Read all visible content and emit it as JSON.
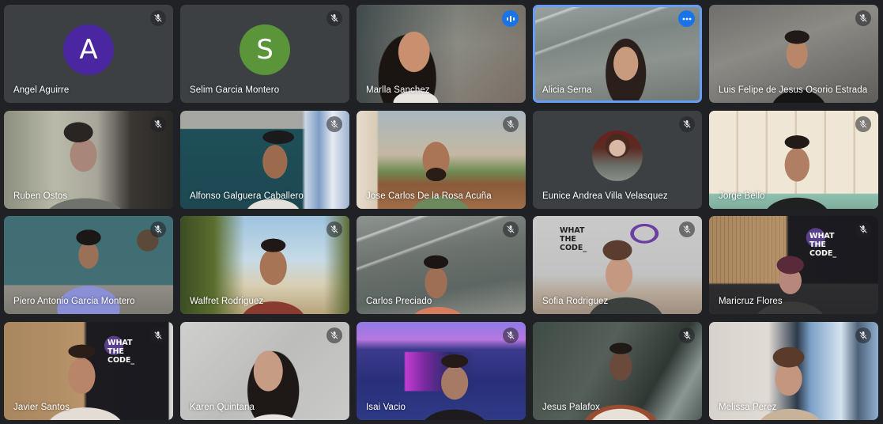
{
  "app": "Google Meet",
  "colors": {
    "page_bg": "#202124",
    "tile_bg": "#3c4043",
    "active_border": "#669df6",
    "badge_blue": "#1a73e8",
    "avatar_purple": "#4a27a0",
    "avatar_green": "#5a953a"
  },
  "participants": [
    {
      "name": "Angel Aguirre",
      "video": false,
      "avatar_letter": "A",
      "muted": true
    },
    {
      "name": "Selim Garcia Montero",
      "video": false,
      "avatar_letter": "S",
      "muted": true
    },
    {
      "name": "Marlla Sanchez",
      "video": true,
      "muted": false,
      "speaking": true
    },
    {
      "name": "Alicia Serna",
      "video": true,
      "muted": false,
      "active": true,
      "indicator": "more-options"
    },
    {
      "name": "Luis Felipe de Jesus Osorio Estrada",
      "video": true,
      "muted": true
    },
    {
      "name": "Ruben Ostos",
      "video": true,
      "muted": true
    },
    {
      "name": "Alfonso Galguera Caballero",
      "video": true,
      "muted": true
    },
    {
      "name": "Jose Carlos De la Rosa Acuña",
      "video": true,
      "muted": true
    },
    {
      "name": "Eunice Andrea Villa Velasquez",
      "video": false,
      "photo_avatar": true,
      "muted": true
    },
    {
      "name": "Jorge Bello",
      "video": true,
      "muted": true
    },
    {
      "name": "Piero Antonio Garcia Montero",
      "video": true,
      "muted": true
    },
    {
      "name": "Walfret Rodriguez",
      "video": true,
      "muted": true
    },
    {
      "name": "Carlos Preciado",
      "video": true,
      "muted": true
    },
    {
      "name": "Sofia Rodriguez",
      "video": true,
      "muted": true
    },
    {
      "name": "Maricruz Flores",
      "video": true,
      "muted": true
    },
    {
      "name": "Javier Santos",
      "video": true,
      "muted": true
    },
    {
      "name": "Karen Quintana",
      "video": true,
      "muted": true
    },
    {
      "name": "Isai Vacio",
      "video": true,
      "muted": true
    },
    {
      "name": "Jesus Palafox",
      "video": true,
      "muted": true
    },
    {
      "name": "Melissa Perez",
      "video": true,
      "muted": true
    }
  ],
  "backgrounds": {
    "wtc_lines": [
      "WHAT",
      "THE",
      "CODE_"
    ]
  }
}
